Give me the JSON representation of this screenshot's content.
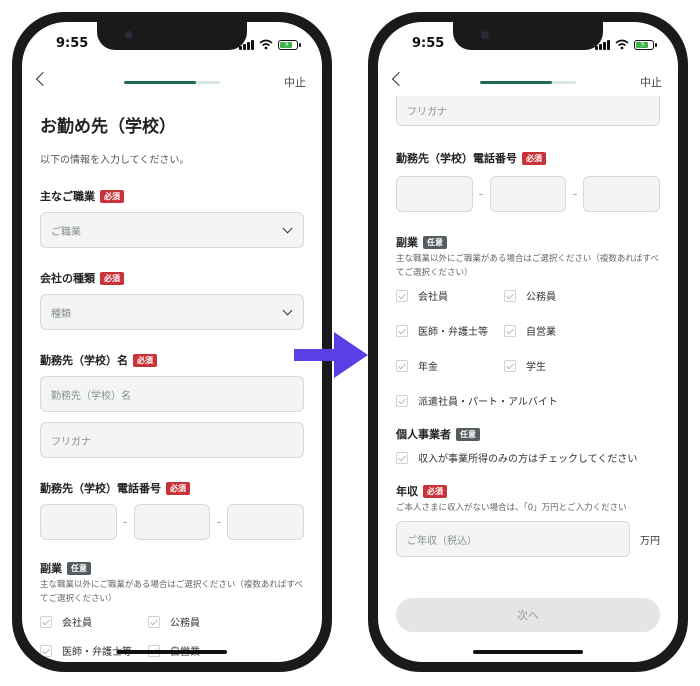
{
  "status": {
    "time": "9:55"
  },
  "nav": {
    "cancel": "中止",
    "progress1": 0.75,
    "progress2": 0.75
  },
  "screen1": {
    "title": "お勤め先（学校）",
    "subtitle": "以下の情報を入力してください。",
    "occupation": {
      "label": "主なご職業",
      "placeholder": "ご職業"
    },
    "company_type": {
      "label": "会社の種類",
      "placeholder": "種類"
    },
    "company_name": {
      "label": "勤務先（学校）名",
      "placeholder": "勤務先（学校）名",
      "kana_placeholder": "フリガナ"
    },
    "phone": {
      "label": "勤務先（学校）電話番号",
      "separator": "–"
    },
    "side_job": {
      "label": "副業",
      "help": "主な職業以外にご職業がある場合はご選択ください（複数あればすべてご選択ください）",
      "options": [
        "会社員",
        "公務員",
        "医師・弁護士等",
        "自営業"
      ]
    }
  },
  "screen2": {
    "kana_placeholder": "フリガナ",
    "phone": {
      "label": "勤務先（学校）電話番号",
      "separator": "–"
    },
    "side_job": {
      "label": "副業",
      "help": "主な職業以外にご職業がある場合はご選択ください（複数あればすべてご選択ください）",
      "options": [
        "会社員",
        "公務員",
        "医師・弁護士等",
        "自営業",
        "年金",
        "学生",
        "派遣社員・パート・アルバイト"
      ]
    },
    "sole_prop": {
      "label": "個人事業者",
      "check": "収入が事業所得のみの方はチェックしてください"
    },
    "income": {
      "label": "年収",
      "help": "ご本人さまに収入がない場合は、「0」万円とご入力ください",
      "placeholder": "ご年収（税込）",
      "unit": "万円"
    },
    "next": "次へ"
  },
  "badges": {
    "required": "必須",
    "optional": "任意"
  }
}
